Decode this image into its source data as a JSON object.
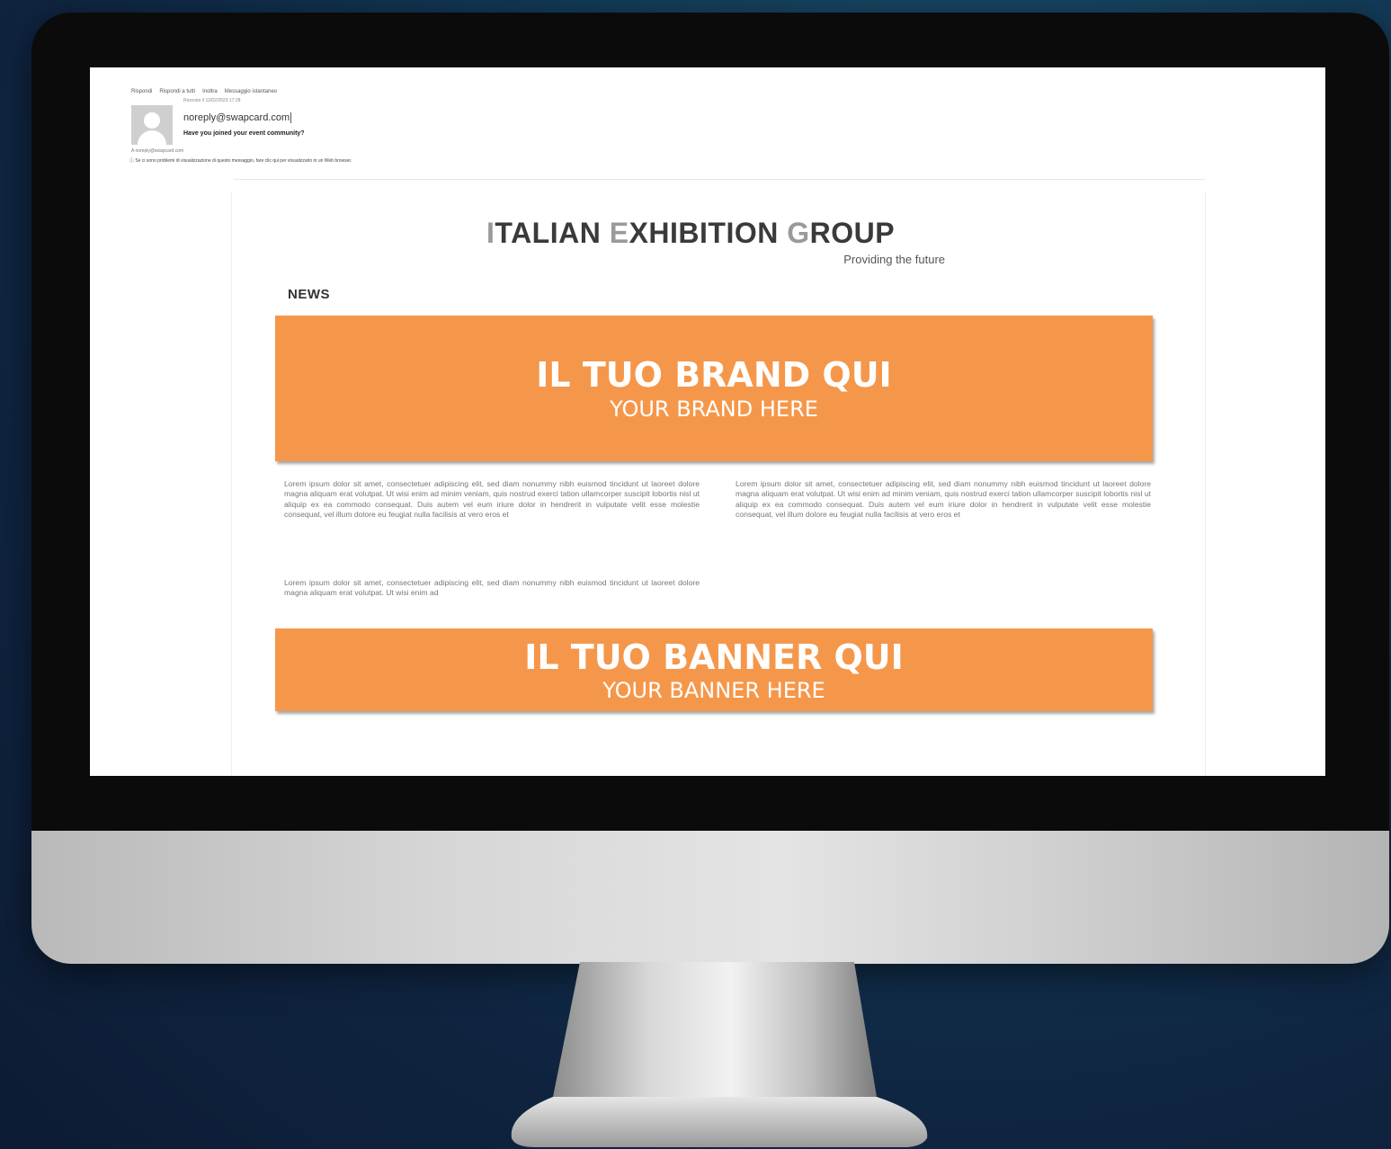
{
  "email": {
    "toolbar": [
      "Rispondi",
      "Rispondi a tutti",
      "Inoltra",
      "Messaggio istantaneo"
    ],
    "received": "Ricevuto il 12/02/2023 17:28",
    "sender": "noreply@swapcard.com",
    "subject": "Have you joined your event community?",
    "meta": "A  noreply@swapcard.com",
    "info": "Se ci sono problemi di visualizzazione di questo messaggio, fare clic qui per visualizzarlo in un Web browser."
  },
  "newsletter": {
    "logo": {
      "part1_lead": "I",
      "part1_rest": "TALIAN ",
      "part2_lead": "E",
      "part2_x": "X",
      "part2_rest": "HIBITION ",
      "part3_lead": "G",
      "part3_rest": "ROUP",
      "tagline": "Providing the future"
    },
    "section_label": "NEWS",
    "brand_banner": {
      "title": "IL TUO BRAND QUI",
      "subtitle": "YOUR BRAND HERE"
    },
    "lorem": {
      "left_1": "Lorem ipsum dolor sit amet, consectetuer adipiscing elit, sed diam nonummy nibh euismod tincidunt ut laoreet dolore magna aliquam erat volutpat. Ut wisi enim ad minim veniam, quis nostrud exerci tation ullamcorper suscipit lobortis nisl ut aliquip ex ea commodo consequat. Duis autem vel eum iriure dolor in hendrerit in vulputate velit esse molestie consequat, vel illum dolore eu feugiat nulla facilisis at vero eros et",
      "left_2": "Lorem ipsum dolor sit amet, consectetuer adipiscing elit, sed diam nonummy nibh euismod tincidunt ut laoreet dolore magna aliquam erat volutpat. Ut wisi enim ad",
      "right_1": "Lorem ipsum dolor sit amet, consectetuer adipiscing elit, sed diam nonummy nibh euismod tincidunt ut laoreet dolore magna aliquam erat volutpat. Ut wisi enim ad minim veniam, quis nostrud exerci tation ullamcorper suscipit lobortis nisl ut aliquip ex ea commodo consequat. Duis autem vel eum iriure dolor in hendrerit in vulputate velit esse molestie consequat, vel illum dolore eu feugiat nulla facilisis at vero eros et"
    },
    "ad_banner": {
      "title": "IL TUO BANNER QUI",
      "subtitle": "YOUR BANNER HERE"
    }
  },
  "colors": {
    "banner": "#f5974a",
    "background": "#0f2440"
  }
}
